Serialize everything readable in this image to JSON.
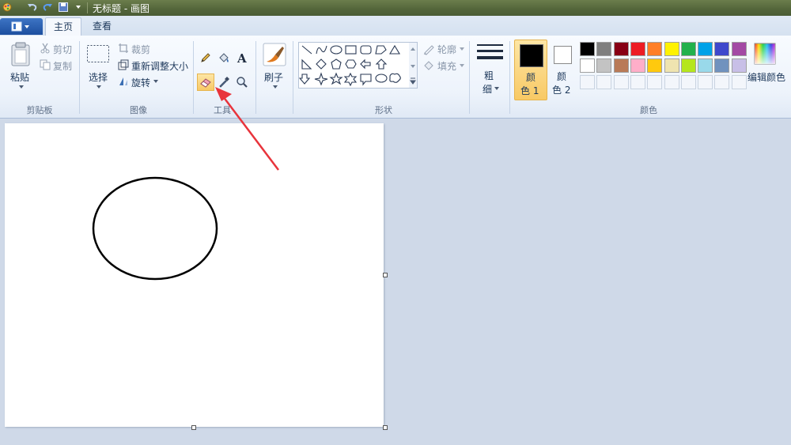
{
  "window": {
    "title": "无标题 - 画图"
  },
  "tabs": [
    {
      "label": "主页",
      "active": true
    },
    {
      "label": "查看",
      "active": false
    }
  ],
  "clipboard": {
    "group_label": "剪贴板",
    "paste": "粘贴",
    "cut": "剪切",
    "copy": "复制"
  },
  "image": {
    "group_label": "图像",
    "select": "选择",
    "crop": "裁剪",
    "resize": "重新调整大小",
    "rotate": "旋转"
  },
  "tools": {
    "group_label": "工具",
    "selected": "eraser-tool"
  },
  "brushes": {
    "label": "刷子"
  },
  "shapes": {
    "group_label": "形状",
    "outline": "轮廓",
    "fill": "填充"
  },
  "size": {
    "label_line1": "粗",
    "label_line2": "细"
  },
  "colors": {
    "group_label": "颜色",
    "color1_line1": "颜",
    "color1_line2": "色 1",
    "color2_line1": "颜",
    "color2_line2": "色 2",
    "edit_colors": "编辑颜色",
    "color1_value": "#000000",
    "color2_value": "#ffffff",
    "palette_row1": [
      "#000000",
      "#7f7f7f",
      "#880015",
      "#ed1c24",
      "#ff7f27",
      "#fff200",
      "#22b14c",
      "#00a2e8",
      "#3f48cc",
      "#a349a4"
    ],
    "palette_row2": [
      "#ffffff",
      "#c3c3c3",
      "#b97a57",
      "#ffaec9",
      "#ffc90e",
      "#efe4b0",
      "#b5e61d",
      "#99d9ea",
      "#7092be",
      "#c8bfe7"
    ]
  },
  "accent": {
    "arrow_color": "#e8343c",
    "selected_tool": "#f8c965"
  }
}
